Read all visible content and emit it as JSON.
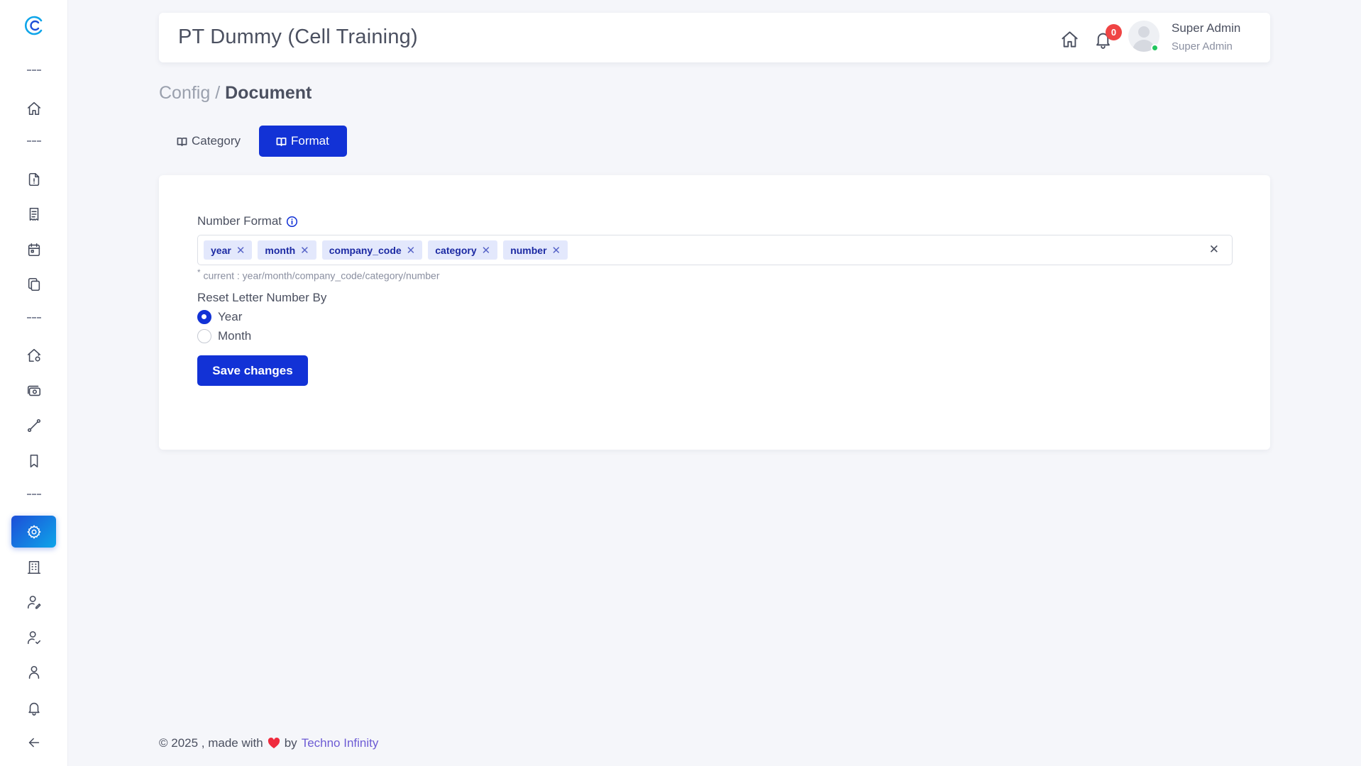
{
  "header": {
    "title": "PT Dummy (Cell Training)",
    "notification_count": "0",
    "user_name": "Super Admin",
    "user_role": "Super Admin"
  },
  "breadcrumb": {
    "parent": "Config",
    "separator": "/",
    "current": "Document"
  },
  "tabs": [
    {
      "label": "Category",
      "active": false,
      "icon": "book-icon"
    },
    {
      "label": "Format",
      "active": true,
      "icon": "book-icon"
    }
  ],
  "form": {
    "number_format_label": "Number Format",
    "tags": [
      "year",
      "month",
      "company_code",
      "category",
      "number"
    ],
    "hint": "current : year/month/company_code/category/number",
    "hint_prefix": "*",
    "reset_label": "Reset Letter Number By",
    "reset_options": [
      {
        "label": "Year",
        "checked": true
      },
      {
        "label": "Month",
        "checked": false
      }
    ],
    "save_label": "Save changes"
  },
  "footer": {
    "prefix": "© 2025 , made with",
    "by": "by",
    "link_text": "Techno Infinity"
  },
  "sidebar": {
    "items": [
      {
        "icon": "home-icon"
      },
      {
        "icon": "document-info-icon"
      },
      {
        "icon": "receipt-icon"
      },
      {
        "icon": "calendar-icon"
      },
      {
        "icon": "copy-icon"
      },
      {
        "icon": "home-settings-icon"
      },
      {
        "icon": "camera-money-icon"
      },
      {
        "icon": "route-icon"
      },
      {
        "icon": "bookmark-icon"
      },
      {
        "icon": "gear-icon",
        "active": true
      },
      {
        "icon": "building-icon"
      },
      {
        "icon": "user-edit-icon"
      },
      {
        "icon": "user-check-icon"
      },
      {
        "icon": "user-icon"
      },
      {
        "icon": "bell-icon"
      },
      {
        "icon": "arrow-left-icon"
      }
    ]
  },
  "colors": {
    "primary": "#1232d6",
    "badge": "#ef4444",
    "online": "#22c55e",
    "link": "#6d5bd4"
  }
}
